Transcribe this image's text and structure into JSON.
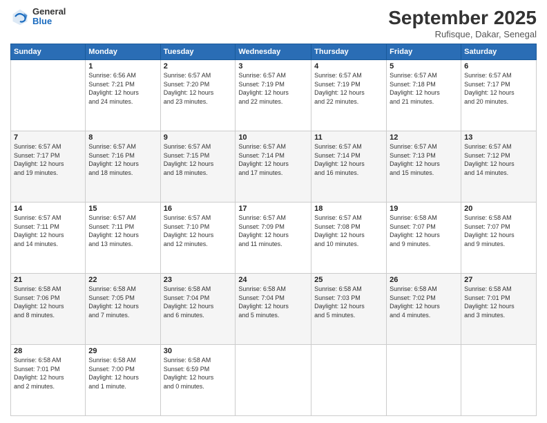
{
  "header": {
    "logo": {
      "general": "General",
      "blue": "Blue"
    },
    "title": "September 2025",
    "subtitle": "Rufisque, Dakar, Senegal"
  },
  "days_of_week": [
    "Sunday",
    "Monday",
    "Tuesday",
    "Wednesday",
    "Thursday",
    "Friday",
    "Saturday"
  ],
  "weeks": [
    [
      {
        "day": "",
        "info": ""
      },
      {
        "day": "1",
        "info": "Sunrise: 6:56 AM\nSunset: 7:21 PM\nDaylight: 12 hours\nand 24 minutes."
      },
      {
        "day": "2",
        "info": "Sunrise: 6:57 AM\nSunset: 7:20 PM\nDaylight: 12 hours\nand 23 minutes."
      },
      {
        "day": "3",
        "info": "Sunrise: 6:57 AM\nSunset: 7:19 PM\nDaylight: 12 hours\nand 22 minutes."
      },
      {
        "day": "4",
        "info": "Sunrise: 6:57 AM\nSunset: 7:19 PM\nDaylight: 12 hours\nand 22 minutes."
      },
      {
        "day": "5",
        "info": "Sunrise: 6:57 AM\nSunset: 7:18 PM\nDaylight: 12 hours\nand 21 minutes."
      },
      {
        "day": "6",
        "info": "Sunrise: 6:57 AM\nSunset: 7:17 PM\nDaylight: 12 hours\nand 20 minutes."
      }
    ],
    [
      {
        "day": "7",
        "info": "Sunrise: 6:57 AM\nSunset: 7:17 PM\nDaylight: 12 hours\nand 19 minutes."
      },
      {
        "day": "8",
        "info": "Sunrise: 6:57 AM\nSunset: 7:16 PM\nDaylight: 12 hours\nand 18 minutes."
      },
      {
        "day": "9",
        "info": "Sunrise: 6:57 AM\nSunset: 7:15 PM\nDaylight: 12 hours\nand 18 minutes."
      },
      {
        "day": "10",
        "info": "Sunrise: 6:57 AM\nSunset: 7:14 PM\nDaylight: 12 hours\nand 17 minutes."
      },
      {
        "day": "11",
        "info": "Sunrise: 6:57 AM\nSunset: 7:14 PM\nDaylight: 12 hours\nand 16 minutes."
      },
      {
        "day": "12",
        "info": "Sunrise: 6:57 AM\nSunset: 7:13 PM\nDaylight: 12 hours\nand 15 minutes."
      },
      {
        "day": "13",
        "info": "Sunrise: 6:57 AM\nSunset: 7:12 PM\nDaylight: 12 hours\nand 14 minutes."
      }
    ],
    [
      {
        "day": "14",
        "info": "Sunrise: 6:57 AM\nSunset: 7:11 PM\nDaylight: 12 hours\nand 14 minutes."
      },
      {
        "day": "15",
        "info": "Sunrise: 6:57 AM\nSunset: 7:11 PM\nDaylight: 12 hours\nand 13 minutes."
      },
      {
        "day": "16",
        "info": "Sunrise: 6:57 AM\nSunset: 7:10 PM\nDaylight: 12 hours\nand 12 minutes."
      },
      {
        "day": "17",
        "info": "Sunrise: 6:57 AM\nSunset: 7:09 PM\nDaylight: 12 hours\nand 11 minutes."
      },
      {
        "day": "18",
        "info": "Sunrise: 6:57 AM\nSunset: 7:08 PM\nDaylight: 12 hours\nand 10 minutes."
      },
      {
        "day": "19",
        "info": "Sunrise: 6:58 AM\nSunset: 7:07 PM\nDaylight: 12 hours\nand 9 minutes."
      },
      {
        "day": "20",
        "info": "Sunrise: 6:58 AM\nSunset: 7:07 PM\nDaylight: 12 hours\nand 9 minutes."
      }
    ],
    [
      {
        "day": "21",
        "info": "Sunrise: 6:58 AM\nSunset: 7:06 PM\nDaylight: 12 hours\nand 8 minutes."
      },
      {
        "day": "22",
        "info": "Sunrise: 6:58 AM\nSunset: 7:05 PM\nDaylight: 12 hours\nand 7 minutes."
      },
      {
        "day": "23",
        "info": "Sunrise: 6:58 AM\nSunset: 7:04 PM\nDaylight: 12 hours\nand 6 minutes."
      },
      {
        "day": "24",
        "info": "Sunrise: 6:58 AM\nSunset: 7:04 PM\nDaylight: 12 hours\nand 5 minutes."
      },
      {
        "day": "25",
        "info": "Sunrise: 6:58 AM\nSunset: 7:03 PM\nDaylight: 12 hours\nand 5 minutes."
      },
      {
        "day": "26",
        "info": "Sunrise: 6:58 AM\nSunset: 7:02 PM\nDaylight: 12 hours\nand 4 minutes."
      },
      {
        "day": "27",
        "info": "Sunrise: 6:58 AM\nSunset: 7:01 PM\nDaylight: 12 hours\nand 3 minutes."
      }
    ],
    [
      {
        "day": "28",
        "info": "Sunrise: 6:58 AM\nSunset: 7:01 PM\nDaylight: 12 hours\nand 2 minutes."
      },
      {
        "day": "29",
        "info": "Sunrise: 6:58 AM\nSunset: 7:00 PM\nDaylight: 12 hours\nand 1 minute."
      },
      {
        "day": "30",
        "info": "Sunrise: 6:58 AM\nSunset: 6:59 PM\nDaylight: 12 hours\nand 0 minutes."
      },
      {
        "day": "",
        "info": ""
      },
      {
        "day": "",
        "info": ""
      },
      {
        "day": "",
        "info": ""
      },
      {
        "day": "",
        "info": ""
      }
    ]
  ]
}
